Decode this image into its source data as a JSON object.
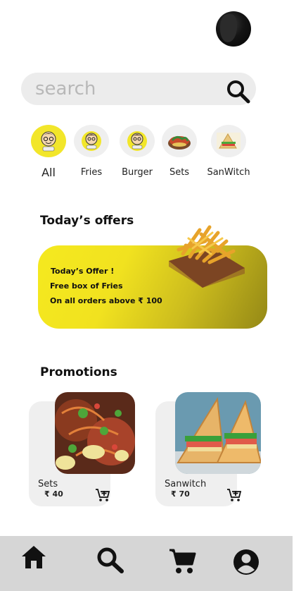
{
  "search": {
    "placeholder": "search"
  },
  "categories": [
    {
      "label": "All",
      "active": true
    },
    {
      "label": "Fries"
    },
    {
      "label": "Burger"
    },
    {
      "label": "Sets"
    },
    {
      "label": "SanWitch"
    }
  ],
  "offers": {
    "heading": "Today’s offers",
    "line1": "Today’s Offer !",
    "line2": "Free box of  Fries",
    "line3": "On all orders above ₹ 100"
  },
  "promotions": {
    "heading": "Promotions",
    "items": [
      {
        "name": "Sets",
        "price": "₹ 40"
      },
      {
        "name": "Sanwitch",
        "price": "₹ 70"
      }
    ]
  },
  "icons": {
    "search": "search-icon",
    "add_to_cart": "cart-plus-icon",
    "nav": [
      "home-icon",
      "search-icon",
      "cart-icon",
      "account-icon"
    ]
  },
  "colors": {
    "accent": "#f2e62a",
    "nav_bg": "#d6d6d6",
    "card_bg": "#efefef"
  }
}
